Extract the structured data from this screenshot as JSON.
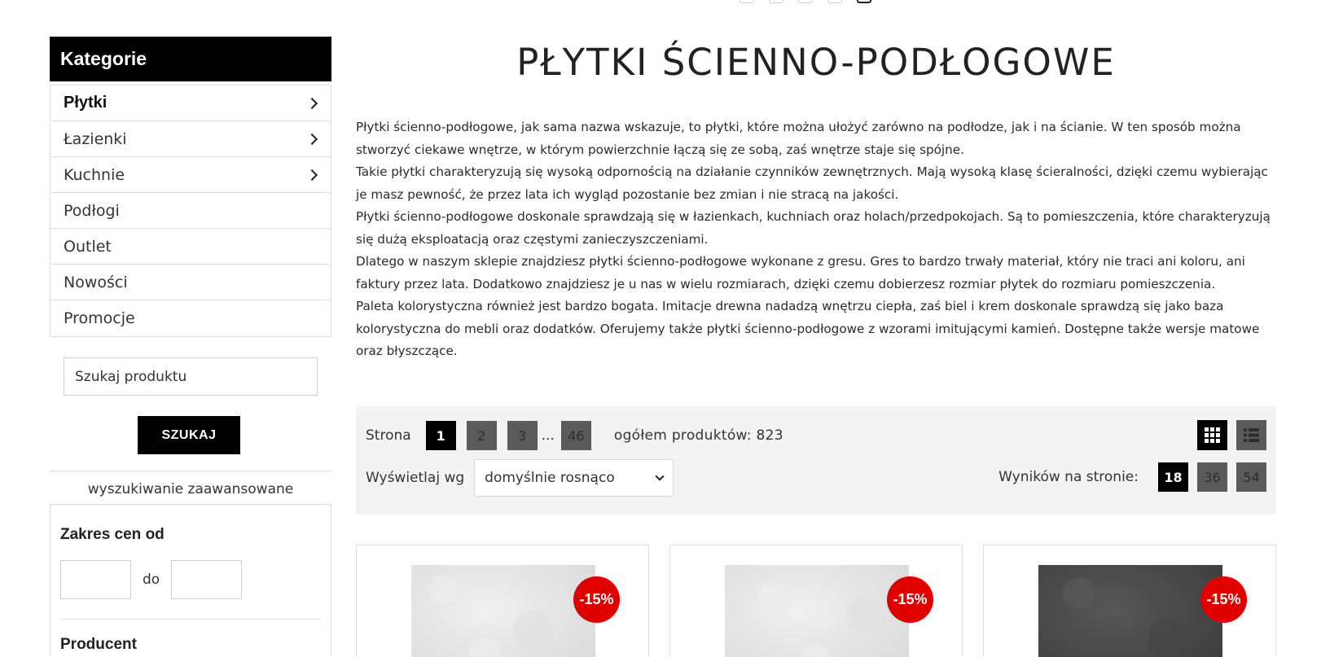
{
  "top_dots": {
    "count": 5,
    "active_index": 4
  },
  "sidebar": {
    "title": "Kategorie",
    "items": [
      {
        "label": "Płytki",
        "has_arrow": true,
        "active": true
      },
      {
        "label": "Łazienki",
        "has_arrow": true,
        "active": false
      },
      {
        "label": "Kuchnie",
        "has_arrow": true,
        "active": false
      },
      {
        "label": "Podłogi",
        "has_arrow": false,
        "active": false
      },
      {
        "label": "Outlet",
        "has_arrow": false,
        "active": false
      },
      {
        "label": "Nowości",
        "has_arrow": false,
        "active": false
      },
      {
        "label": "Promocje",
        "has_arrow": false,
        "active": false
      }
    ],
    "search": {
      "placeholder": "Szukaj produktu",
      "button_label": "SZUKAJ"
    },
    "advanced_search_label": "wyszukiwanie zaawansowane",
    "price_filter": {
      "title": "Zakres cen od",
      "to_label": "do",
      "from_value": "",
      "to_value": ""
    },
    "producer_title": "Producent"
  },
  "main": {
    "title": "PŁYTKI ŚCIENNO-PODŁOGOWE",
    "description": [
      "Płytki ścienno-podłogowe, jak sama nazwa wskazuje, to płytki, które można ułożyć zarówno na podłodze, jak i na ścianie. W ten sposób można stworzyć ciekawe wnętrze, w którym powierzchnie łączą się ze sobą, zaś wnętrze staje się spójne.",
      "Takie płytki charakteryzują się wysoką odpornością na działanie czynników zewnętrznych. Mają wysoką klasę ścieralności, dzięki czemu wybierając je masz pewność, że przez lata ich wygląd pozostanie bez zmian i nie stracą na jakości.",
      "Płytki ścienno-podłogowe doskonale sprawdzają się w łazienkach, kuchniach oraz holach/przedpokojach. Są to pomieszczenia, które charakteryzują się dużą eksploatacją oraz częstymi zanieczyszczeniami.",
      "Dlatego w naszym sklepie znajdziesz płytki ścienno-podłogowe wykonane z gresu. Gres to bardzo trwały materiał, który nie traci ani koloru, ani faktury przez lata. Dodatkowo znajdziesz je u nas w wielu rozmiarach, dzięki czemu dobierzesz rozmiar płytek do rozmiaru pomieszczenia.",
      "Paleta kolorystyczna również jest bardzo bogata. Imitacje drewna nadadzą wnętrzu ciepła, zaś biel i krem doskonale sprawdzą się jako baza kolorystyczna do mebli oraz dodatków. Oferujemy także płytki ścienno-podłogowe z wzorami imitującymi kamień. Dostępne także wersje matowe oraz błyszczące."
    ],
    "toolbar": {
      "page_label": "Strona",
      "pages": [
        "1",
        "2",
        "3"
      ],
      "ellipsis": "...",
      "last_page": "46",
      "current_page": "1",
      "total_label": "ogółem produktów: 823",
      "sort_label": "Wyświetlaj wg",
      "sort_value": "domyślnie rosnąco",
      "per_page_label": "Wyników na stronie:",
      "per_page_options": [
        "18",
        "36",
        "54"
      ],
      "per_page_selected": "18",
      "view_modes": [
        "grid-view-icon",
        "list-view-icon"
      ],
      "active_view": "grid-view-icon"
    },
    "products": [
      {
        "discount": "-15%",
        "thumb_color": "#e6e6e6"
      },
      {
        "discount": "-15%",
        "thumb_color": "#e6e6e6"
      },
      {
        "discount": "-15%",
        "thumb_color": "#4a4a4a"
      }
    ]
  },
  "colors": {
    "accent_black": "#000000",
    "badge_red": "#e00000",
    "toolbar_bg": "#f3f3f3",
    "inactive_btn": "#5a5a5a"
  }
}
